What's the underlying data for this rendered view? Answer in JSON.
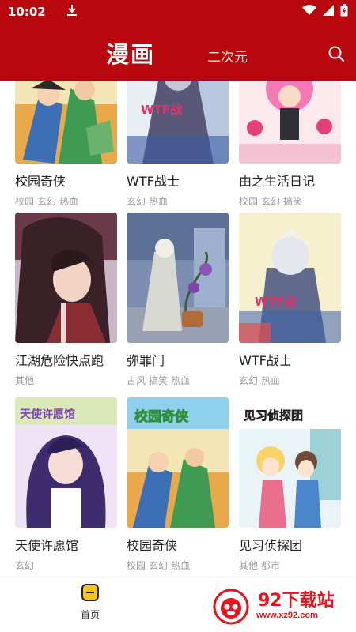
{
  "status_bar": {
    "time": "10:02",
    "download_icon": "download-arrow",
    "wifi_icon": "wifi",
    "signal_icon": "signal",
    "battery_icon": "battery"
  },
  "header": {
    "tab_main": "漫画",
    "tab_secondary": "二次元",
    "search_icon": "search"
  },
  "comics": [
    {
      "title": "校园奇侠",
      "tags": [
        "校园",
        "玄幻",
        "热血"
      ]
    },
    {
      "title": "WTF战士",
      "tags": [
        "玄幻",
        "热血"
      ]
    },
    {
      "title": "由之生活日记",
      "tags": [
        "校园",
        "玄幻",
        "搞笑"
      ]
    },
    {
      "title": "江湖危险快点跑",
      "tags": [
        "其他"
      ]
    },
    {
      "title": "弥罪门",
      "tags": [
        "古风",
        "搞笑",
        "热血"
      ]
    },
    {
      "title": "WTF战士",
      "tags": [
        "玄幻",
        "热血"
      ]
    },
    {
      "title": "天使许愿馆",
      "tags": [
        "玄幻"
      ]
    },
    {
      "title": "校园奇侠",
      "tags": [
        "校园",
        "玄幻",
        "热血"
      ]
    },
    {
      "title": "见习侦探团",
      "tags": [
        "其他",
        "都市"
      ]
    }
  ],
  "cover_text": {
    "wtf": "WTF战",
    "angel": "天使许愿馆",
    "campus": "校园奇侠",
    "detective": "见习侦探团"
  },
  "bottom_nav": {
    "home_label": "首页"
  },
  "watermark": {
    "name": "92下载站",
    "url": "www.xz92.com"
  }
}
